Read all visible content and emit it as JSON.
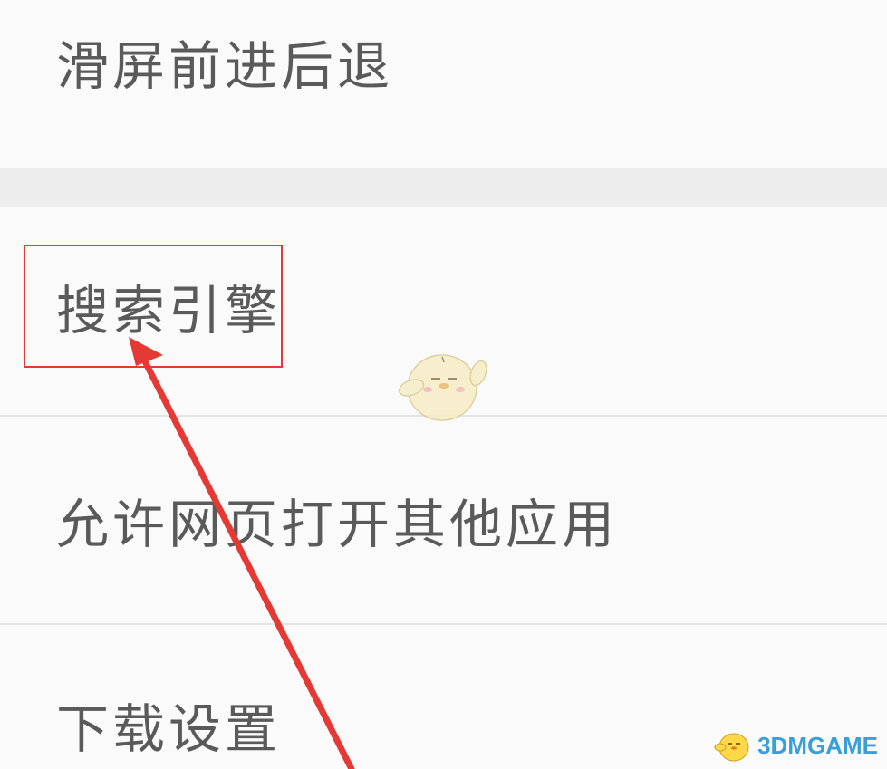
{
  "settings": {
    "items": [
      {
        "label": "滑屏前进后退"
      },
      {
        "label": "搜索引擎"
      },
      {
        "label": "允许网页打开其他应用"
      },
      {
        "label": "下载设置"
      }
    ]
  },
  "annotation": {
    "highlight_color": "#e53935",
    "highlighted_item": "搜索引擎"
  },
  "watermark": {
    "text": "3DMGAME",
    "color": "#3a9fd8"
  },
  "icons": {
    "mascot": "mascot-icon",
    "watermark_mascot": "watermark-mascot-icon",
    "arrow": "red-arrow"
  }
}
